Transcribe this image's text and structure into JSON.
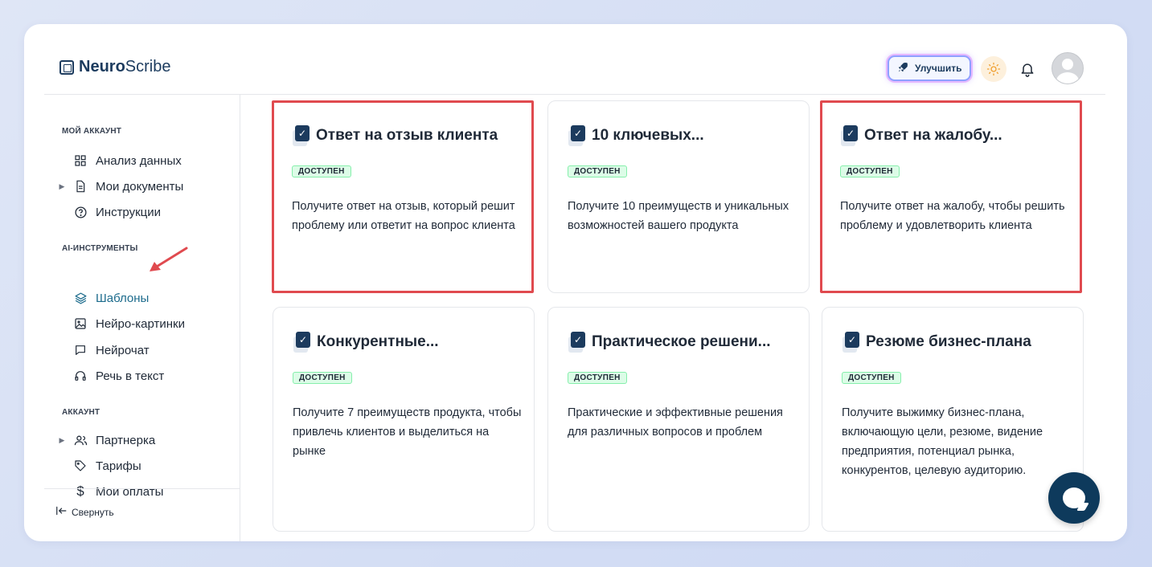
{
  "header": {
    "logo_bold": "Neuro",
    "logo_regular": "Scribe",
    "upgrade_label": "Улучшить"
  },
  "sidebar": {
    "sections": [
      {
        "title": "МОЙ АККАУНТ"
      },
      {
        "title": "AI-ИНСТРУМЕНТЫ"
      },
      {
        "title": "АККАУНТ"
      }
    ],
    "items": [
      {
        "label": "Анализ данных",
        "icon": "grid-icon"
      },
      {
        "label": "Мои документы",
        "icon": "document-icon",
        "expandable": true
      },
      {
        "label": "Инструкции",
        "icon": "help-circle-icon"
      },
      {
        "label": "Шаблоны",
        "icon": "layers-icon",
        "active": true
      },
      {
        "label": "Нейро-картинки",
        "icon": "image-icon"
      },
      {
        "label": "Нейрочат",
        "icon": "chat-icon"
      },
      {
        "label": "Речь в текст",
        "icon": "headphones-icon"
      },
      {
        "label": "Партнерка",
        "icon": "users-icon",
        "expandable": true
      },
      {
        "label": "Тарифы",
        "icon": "tag-icon"
      },
      {
        "label": "Мои оплаты",
        "icon": "dollar-icon"
      }
    ],
    "collapse_label": "Свернуть"
  },
  "cards": [
    {
      "title": "Ответ на отзыв клиента",
      "badge": "ДОСТУПЕН",
      "description": "Получите ответ на отзыв, который решит проблему или ответит на вопрос клиента",
      "highlighted": true
    },
    {
      "title": "10 ключевых...",
      "badge": "ДОСТУПЕН",
      "description": "Получите 10 преимуществ и уникальных возможностей вашего продукта",
      "highlighted": false
    },
    {
      "title": "Ответ на жалобу...",
      "badge": "ДОСТУПЕН",
      "description": "Получите ответ на жалобу, чтобы решить проблему и удовлетворить клиента",
      "highlighted": true
    },
    {
      "title": "Конкурентные...",
      "badge": "ДОСТУПЕН",
      "description": "Получите 7 преимуществ продукта, чтобы привлечь клиентов и выделиться на рынке",
      "highlighted": false
    },
    {
      "title": "Практическое решени...",
      "badge": "ДОСТУПЕН",
      "description": "Практические и эффективные решения для различных вопросов и проблем",
      "highlighted": false
    },
    {
      "title": "Резюме бизнес-плана",
      "badge": "ДОСТУПЕН",
      "description": "Получите выжимку бизнес-плана, включающую цели, резюме, видение предприятия, потенциал рынка, конкурентов, целевую аудиторию.",
      "highlighted": false
    }
  ],
  "colors": {
    "accent": "#1c3b5e",
    "active_nav": "#1c6b8c",
    "highlight_border": "#e04a4f",
    "badge_bg": "#dcfce7"
  }
}
